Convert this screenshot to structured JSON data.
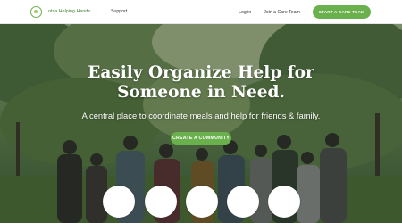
{
  "header": {
    "logo_text": "Lotsa Helping Hands",
    "support_label": "Support",
    "login_label": "Log in",
    "join_label": "Join a Care Team",
    "start_button_label": "START A CARE TEAM"
  },
  "hero": {
    "headline": "Easily Organize Help for Someone in Need.",
    "subhead": "A central place to coordinate meals and help for friends & family.",
    "cta_label": "CREATE A COMMUNITY"
  },
  "colors": {
    "brand_green": "#6ab04c",
    "logo_text_green": "#3a7d2c"
  },
  "icons": [
    "logo-ring-icon"
  ]
}
